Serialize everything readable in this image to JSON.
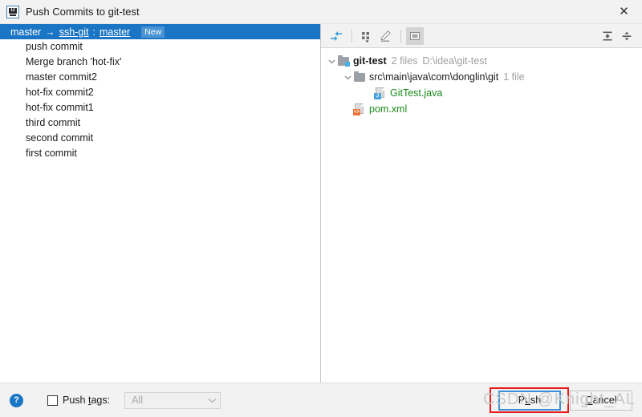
{
  "window": {
    "title": "Push Commits to git-test",
    "app_icon": "intellij-idea-icon",
    "icon_letters": "IJ",
    "close_label": "✕"
  },
  "commits_panel": {
    "branch_row": {
      "local_branch": "master",
      "arrow": "→",
      "remote_name": "ssh-git",
      "separator": ":",
      "remote_branch": "master",
      "badge": "New",
      "selected": true,
      "selected_color": "#1a75c4",
      "badge_color": "#4a93d4"
    },
    "commits": [
      {
        "message": "push commit"
      },
      {
        "message": "Merge branch 'hot-fix'"
      },
      {
        "message": "master commit2"
      },
      {
        "message": "hot-fix commit2"
      },
      {
        "message": "hot-fix commit1"
      },
      {
        "message": "third commit"
      },
      {
        "message": "second commit"
      },
      {
        "message": "first commit"
      }
    ]
  },
  "files_panel": {
    "toolbar": {
      "left_buttons": [
        {
          "icon": "expand-collapse-diff-icon",
          "active": false
        },
        {
          "icon": "group-by-icon",
          "active": false
        },
        {
          "icon": "edit-pencil-icon",
          "active": false
        },
        {
          "icon": "preview-panel-icon",
          "active": true
        }
      ],
      "right_buttons": [
        {
          "icon": "expand-all-icon"
        },
        {
          "icon": "collapse-all-icon"
        }
      ]
    },
    "tree": [
      {
        "icon": "folder-vcs-icon",
        "name": "git-test",
        "bold": true,
        "meta1": "2 files",
        "meta2": "D:\\idea\\git-test",
        "depth": 0,
        "expanded": true
      },
      {
        "icon": "folder-icon",
        "name": "src\\main\\java\\com\\donglin\\git",
        "bold": false,
        "meta1": "1 file",
        "meta2": "",
        "depth": 1,
        "expanded": true
      },
      {
        "icon": "java-file-icon",
        "name": "GitTest.java",
        "green": true,
        "depth": 2,
        "expanded": null
      },
      {
        "icon": "xml-file-icon",
        "name": "pom.xml",
        "green": true,
        "depth": 1,
        "expanded": null
      }
    ]
  },
  "bottom_bar": {
    "help_label": "?",
    "push_tags": {
      "checked": false,
      "label_pre": "Push ",
      "label_mnemonic": "t",
      "label_post": "ags:",
      "combo_value": "All",
      "combo_enabled": false,
      "chevron": "⌄"
    },
    "buttons": [
      {
        "id": "push",
        "label_pre": "P",
        "label_mnemonic": "u",
        "label_post": "sh",
        "default": true,
        "annotated": true
      },
      {
        "id": "cancel",
        "label_pre": "",
        "label_mnemonic": "C",
        "label_post": "ancel",
        "default": false,
        "annotated": false
      }
    ]
  },
  "watermark": {
    "text": "CSDN @Knight_AL",
    "color": "#c9c9c9"
  }
}
